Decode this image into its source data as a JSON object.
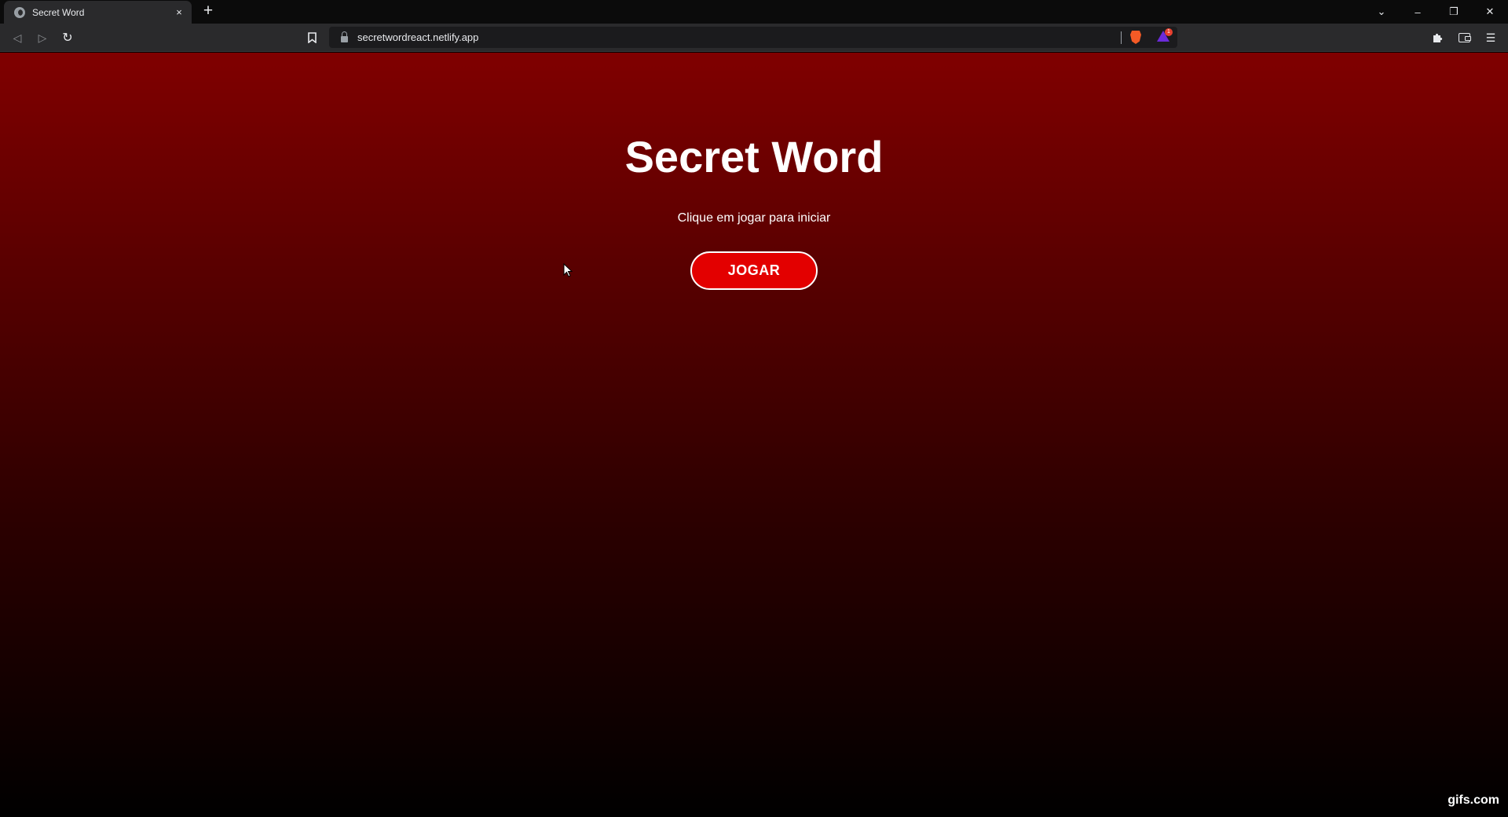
{
  "browser": {
    "tab": {
      "title": "Secret Word",
      "close_icon": "×"
    },
    "new_tab_icon": "+",
    "window_controls": {
      "tabs_dropdown": "⌄",
      "minimize": "–",
      "restore": "❐",
      "close": "✕"
    },
    "toolbar": {
      "back_icon": "◁",
      "forward_icon": "▷",
      "reload_icon": "↻",
      "url": "secretwordreact.netlify.app",
      "rewards_badge": "1",
      "extensions_icon": "puzzle-icon",
      "wallet_icon": "wallet-icon",
      "menu_icon": "☰"
    }
  },
  "page": {
    "title": "Secret Word",
    "subtitle": "Clique em jogar para iniciar",
    "play_button": "JOGAR",
    "watermark": "gifs.com"
  },
  "colors": {
    "background_top": "#800000",
    "background_bottom": "#000000",
    "button": "#e30000",
    "text": "#ffffff"
  }
}
